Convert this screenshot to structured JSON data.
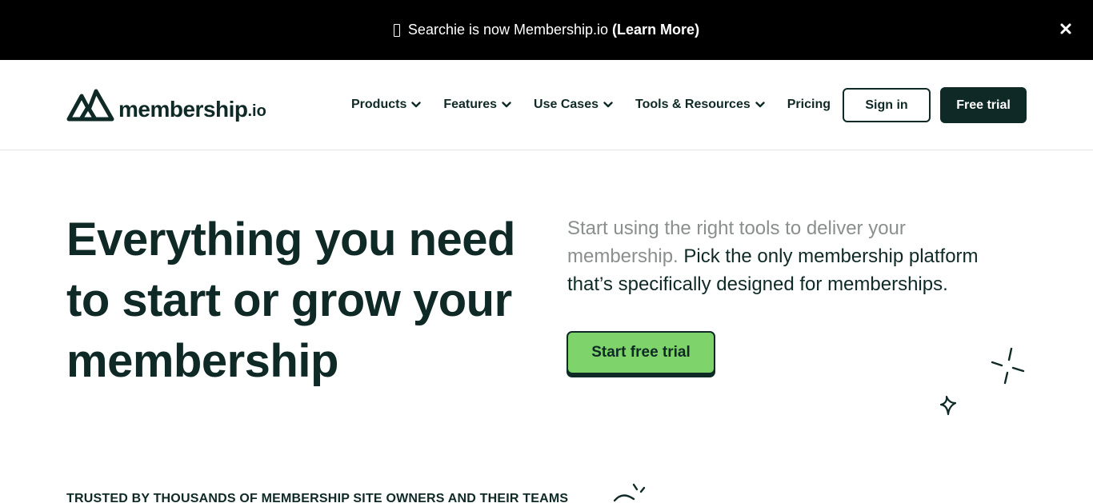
{
  "announcement": {
    "text": "Searchie is now Membership.io",
    "link_label": "(Learn More)",
    "close_icon": "close-icon"
  },
  "logo": {
    "word": "membership",
    "suffix": ".io",
    "icon": "mountain-logo-icon"
  },
  "nav": {
    "items": [
      {
        "label": "Products",
        "has_dropdown": true
      },
      {
        "label": "Features",
        "has_dropdown": true
      },
      {
        "label": "Use Cases",
        "has_dropdown": true
      },
      {
        "label": "Tools & Resources",
        "has_dropdown": true
      },
      {
        "label": "Pricing",
        "has_dropdown": false
      }
    ],
    "signin_label": "Sign in",
    "trial_label": "Free trial"
  },
  "hero": {
    "title": "Everything you need to start or grow your membership",
    "subtitle_muted": "Start using the right tools to deliver your membership.",
    "subtitle_strong": "Pick the only membership platform that’s specifically designed for memberships.",
    "cta_label": "Start free trial"
  },
  "trusted": {
    "text": "TRUSTED BY THOUSANDS OF MEMBERSHIP SITE OWNERS AND THEIR TEAMS"
  },
  "colors": {
    "brand_dark": "#0f2a26",
    "cta_green": "#7ed46a",
    "announcement_bg": "#000000",
    "muted_text": "#8a8f8e"
  }
}
